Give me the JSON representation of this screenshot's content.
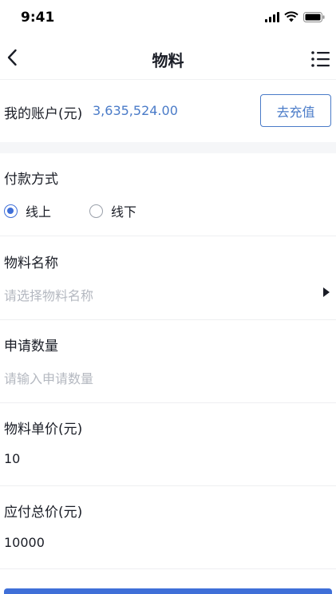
{
  "status_bar": {
    "time": "9:41"
  },
  "nav": {
    "title": "物料"
  },
  "account": {
    "label": "我的账户(元)",
    "amount": "3,635,524.00",
    "recharge_label": "去充值"
  },
  "payment": {
    "label": "付款方式",
    "options": [
      {
        "label": "线上",
        "selected": true
      },
      {
        "label": "线下",
        "selected": false
      }
    ]
  },
  "material_name": {
    "label": "物料名称",
    "placeholder": "请选择物料名称"
  },
  "quantity": {
    "label": "申请数量",
    "placeholder": "请输入申请数量"
  },
  "unit_price": {
    "label": "物料单价(元)",
    "value": "10"
  },
  "total_price": {
    "label": "应付总价(元)",
    "value": "10000"
  },
  "colors": {
    "accent": "#3f6fd8",
    "amount": "#4a7bc8",
    "placeholder": "#b4b8c0"
  }
}
